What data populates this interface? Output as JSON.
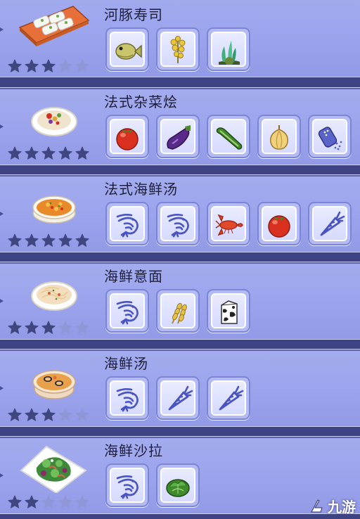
{
  "recipes": [
    {
      "name": "河豚寿司",
      "rating": 3,
      "max_rating": 5,
      "dish_icon": "sushi-plate-icon",
      "ingredients": [
        {
          "icon": "pufferfish-icon"
        },
        {
          "icon": "rice-flower-icon"
        },
        {
          "icon": "seaweed-icon"
        }
      ]
    },
    {
      "name": "法式杂菜烩",
      "rating": 5,
      "max_rating": 5,
      "dish_icon": "ratatouille-plate-icon",
      "ingredients": [
        {
          "icon": "tomato-icon"
        },
        {
          "icon": "eggplant-icon"
        },
        {
          "icon": "zucchini-icon"
        },
        {
          "icon": "onion-icon"
        },
        {
          "icon": "salt-shaker-icon"
        }
      ]
    },
    {
      "name": "法式海鲜汤",
      "rating": 5,
      "max_rating": 5,
      "dish_icon": "bouillabaisse-bowl-icon",
      "ingredients": [
        {
          "icon": "shrimp-icon"
        },
        {
          "icon": "shrimp-icon"
        },
        {
          "icon": "lobster-icon"
        },
        {
          "icon": "tomato-icon"
        },
        {
          "icon": "carrot-icon"
        }
      ]
    },
    {
      "name": "海鲜意面",
      "rating": 3,
      "max_rating": 5,
      "dish_icon": "seafood-pasta-plate-icon",
      "ingredients": [
        {
          "icon": "shrimp-icon"
        },
        {
          "icon": "wheat-icon"
        },
        {
          "icon": "milk-carton-icon"
        }
      ]
    },
    {
      "name": "海鲜汤",
      "rating": 3,
      "max_rating": 5,
      "dish_icon": "seafood-soup-bowl-icon",
      "ingredients": [
        {
          "icon": "shrimp-icon"
        },
        {
          "icon": "carrot-icon"
        },
        {
          "icon": "carrot-icon"
        }
      ]
    },
    {
      "name": "海鲜沙拉",
      "rating": 2,
      "max_rating": 5,
      "dish_icon": "seafood-salad-plate-icon",
      "ingredients": [
        {
          "icon": "shrimp-icon"
        },
        {
          "icon": "lettuce-icon"
        }
      ]
    }
  ],
  "watermark": {
    "text": "九游",
    "icon": "jiuyou-logo-icon"
  },
  "colors": {
    "star_filled": "#404680",
    "star_empty": "#8f96d8",
    "row_bg": "#9ea6ee",
    "slot_border": "#7c84d4"
  }
}
